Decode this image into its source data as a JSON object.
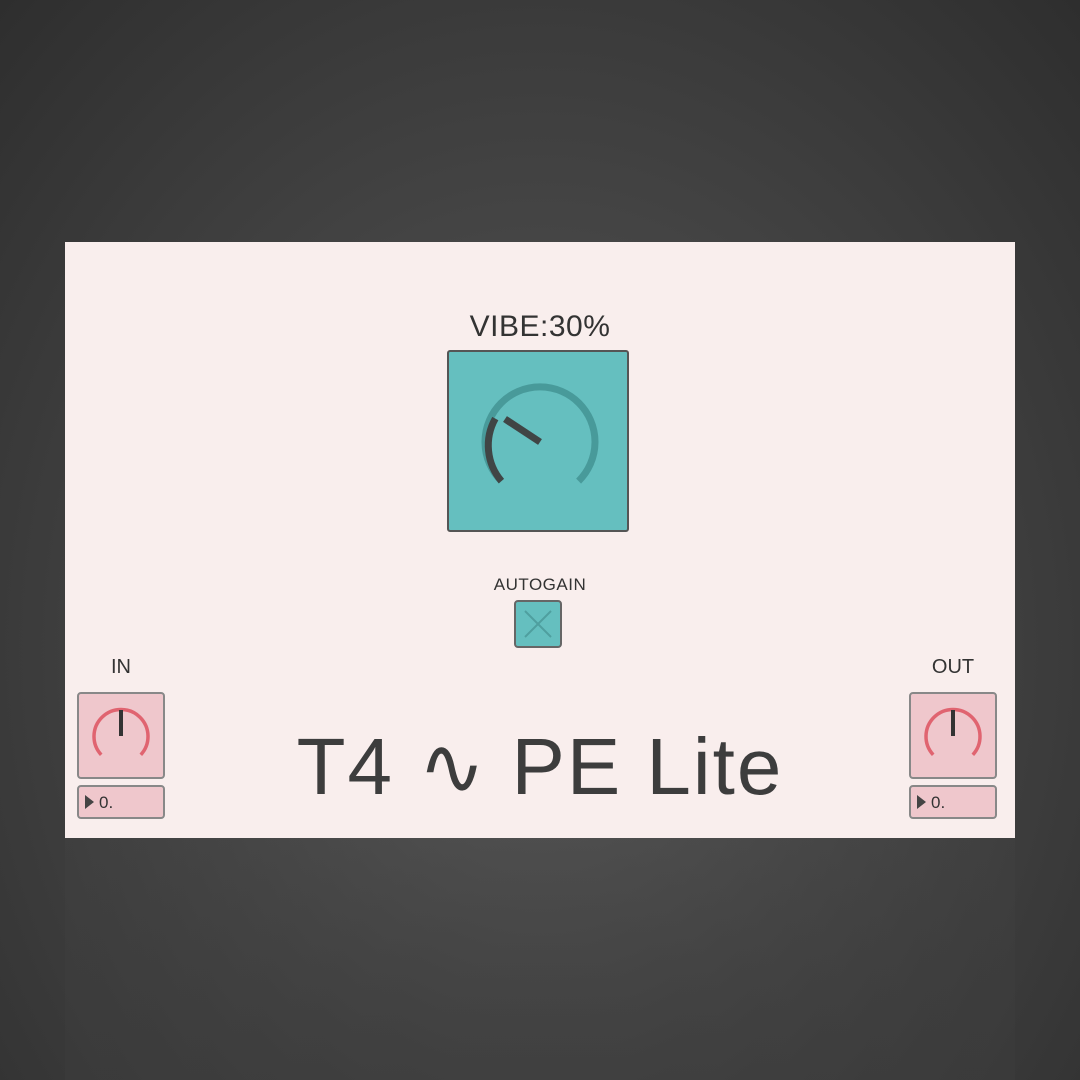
{
  "plugin": {
    "title": "T4 ∿ PE Lite",
    "vibe": {
      "label": "VIBE:30%",
      "value_percent": 30,
      "knob_color": "#65bfbf"
    },
    "autogain": {
      "label": "AUTOGAIN",
      "checked": true
    },
    "input": {
      "label": "IN",
      "value": "0."
    },
    "output": {
      "label": "OUT",
      "value": "0."
    },
    "colors": {
      "panel": "#f9eeed",
      "teal": "#65bfbf",
      "pink": "#efc7cc",
      "arc_red": "#e06470"
    }
  }
}
